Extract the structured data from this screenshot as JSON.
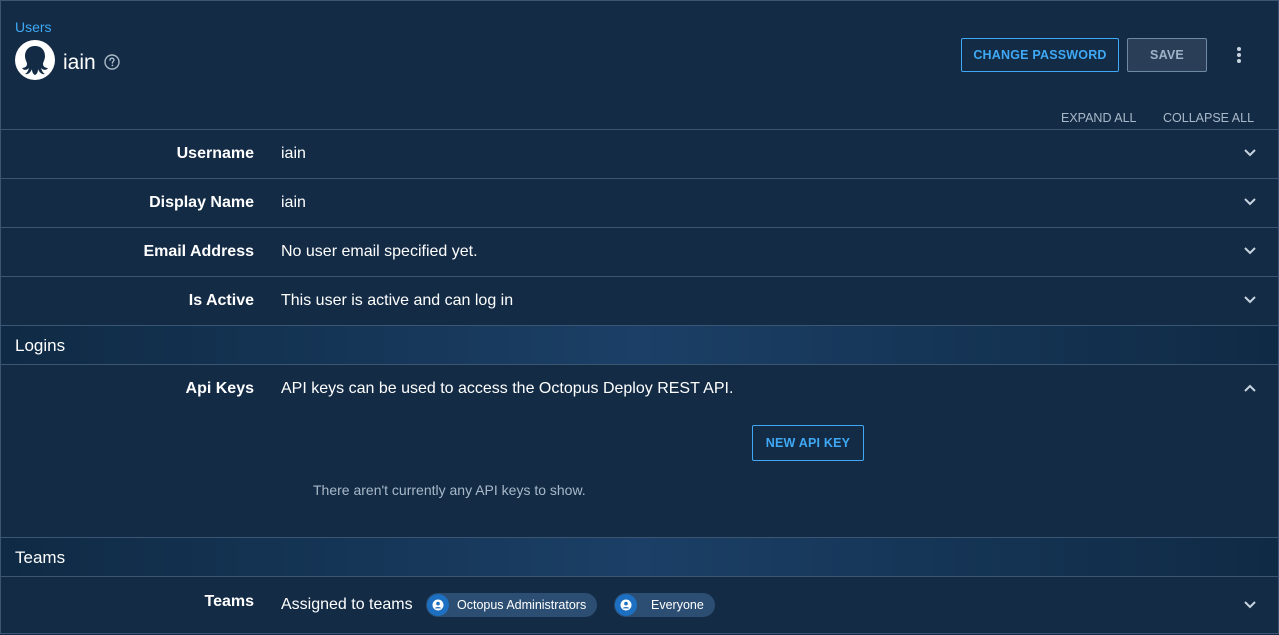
{
  "header": {
    "breadcrumb": "Users",
    "title": "iain",
    "change_password_label": "CHANGE PASSWORD",
    "save_label": "SAVE",
    "expand_all_label": "EXPAND ALL",
    "collapse_all_label": "COLLAPSE ALL"
  },
  "fields": [
    {
      "label": "Username",
      "value": "iain"
    },
    {
      "label": "Display Name",
      "value": "iain"
    },
    {
      "label": "Email Address",
      "value": "No user email specified yet."
    },
    {
      "label": "Is Active",
      "value": "This user is active and can log in"
    }
  ],
  "logins": {
    "section_title": "Logins",
    "api_keys_label": "Api Keys",
    "api_keys_description": "API keys can be used to access the Octopus Deploy REST API.",
    "new_api_key_label": "NEW API KEY",
    "empty_message": "There aren't currently any API keys to show."
  },
  "teams": {
    "section_title": "Teams",
    "label": "Teams",
    "summary": "Assigned to teams",
    "chips": [
      "Octopus Administrators",
      "Everyone"
    ]
  },
  "colors": {
    "background": "#132b45",
    "accent": "#3fa9f5",
    "chip_bg": "#2c4e72",
    "chip_icon": "#1c6fc1"
  },
  "icons": {
    "avatar": "octopus-avatar-icon",
    "help": "help-circle-icon",
    "more": "more-vertical-icon",
    "chevron_down": "chevron-down-icon",
    "chevron_up": "chevron-up-icon",
    "team": "team-user-icon"
  }
}
